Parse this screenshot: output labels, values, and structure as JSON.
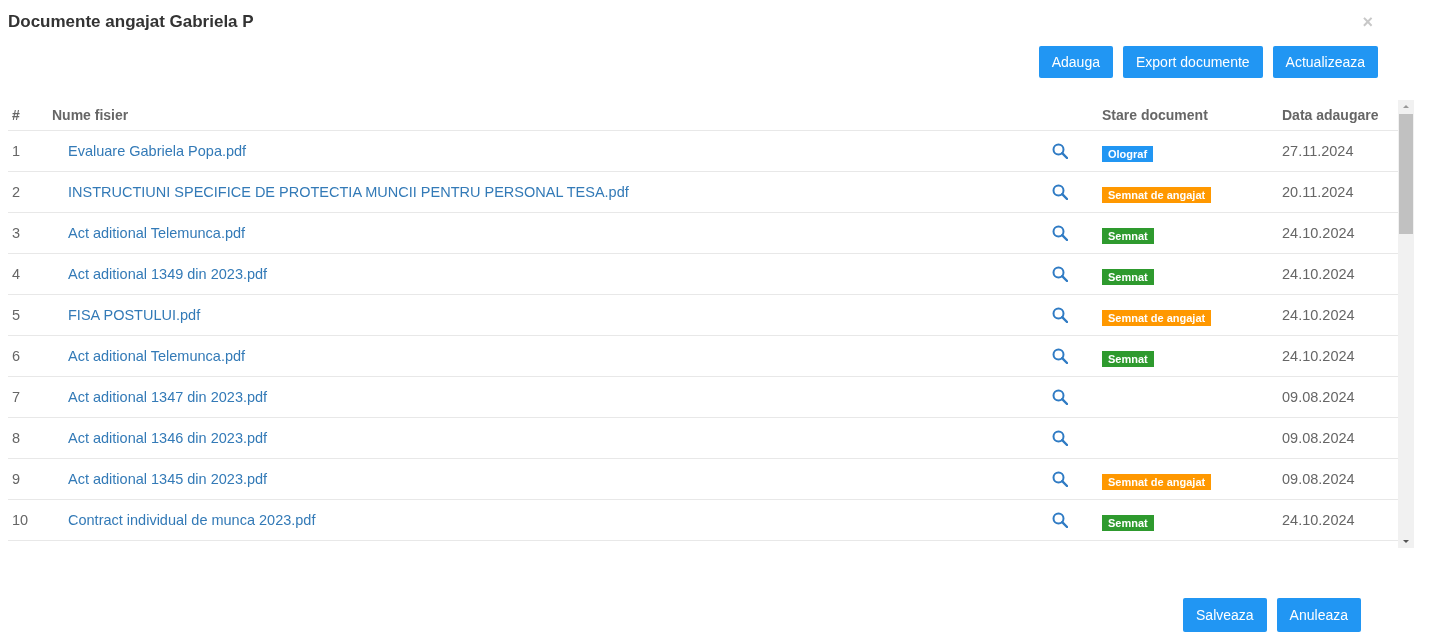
{
  "dialog": {
    "title": "Documente angajat Gabriela P",
    "close": "×"
  },
  "toolbar": [
    "Adauga",
    "Export documente",
    "Actualizeaza"
  ],
  "table": {
    "columns": [
      "#",
      "Nume fisier",
      "Stare document",
      "Data adaugare"
    ],
    "rows": [
      {
        "index": "1",
        "file": "Evaluare Gabriela Popa.pdf",
        "status": {
          "label": "Olograf",
          "color": "#2196f3"
        },
        "date": "27.11.2024"
      },
      {
        "index": "2",
        "file": "INSTRUCTIUNI SPECIFICE DE PROTECTIA MUNCII PENTRU PERSONAL TESA.pdf",
        "status": {
          "label": "Semnat de angajat",
          "color": "#ff9800"
        },
        "date": "20.11.2024"
      },
      {
        "index": "3",
        "file": "Act aditional Telemunca.pdf",
        "status": {
          "label": "Semnat",
          "color": "#2e9a2e"
        },
        "date": "24.10.2024"
      },
      {
        "index": "4",
        "file": "Act aditional 1349 din 2023.pdf",
        "status": {
          "label": "Semnat",
          "color": "#2e9a2e"
        },
        "date": "24.10.2024"
      },
      {
        "index": "5",
        "file": "FISA POSTULUI.pdf",
        "status": {
          "label": "Semnat de angajat",
          "color": "#ff9800"
        },
        "date": "24.10.2024"
      },
      {
        "index": "6",
        "file": "Act aditional Telemunca.pdf",
        "status": {
          "label": "Semnat",
          "color": "#2e9a2e"
        },
        "date": "24.10.2024"
      },
      {
        "index": "7",
        "file": "Act aditional 1347 din 2023.pdf",
        "date": "09.08.2024"
      },
      {
        "index": "8",
        "file": "Act aditional 1346 din 2023.pdf",
        "date": "09.08.2024"
      },
      {
        "index": "9",
        "file": "Act aditional 1345 din 2023.pdf",
        "status": {
          "label": "Semnat de angajat",
          "color": "#ff9800"
        },
        "date": "09.08.2024"
      },
      {
        "index": "10",
        "file": "Contract individual de munca 2023.pdf",
        "status": {
          "label": "Semnat",
          "color": "#2e9a2e"
        },
        "date": "24.10.2024"
      }
    ]
  },
  "footer": [
    "Salveaza",
    "Anuleaza"
  ]
}
